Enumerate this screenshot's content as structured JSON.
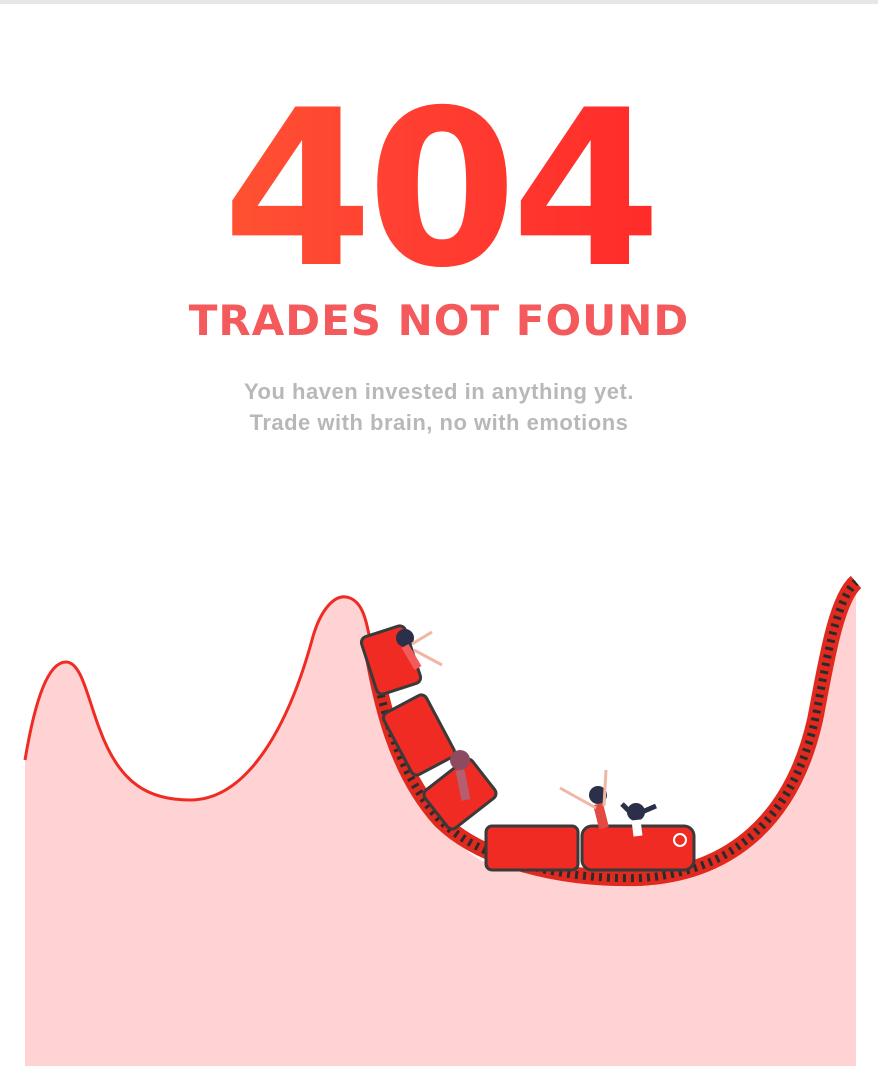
{
  "error": {
    "code": "404",
    "headline": "TRADES NOT FOUND",
    "message_line1": "You haven invested in anything yet.",
    "message_line2": "Trade with brain, no with emotions"
  },
  "colors": {
    "accent_start": "#ff6a33",
    "accent_end": "#ff1a22",
    "headline": "#f4595c",
    "muted_text": "#b8b8b8",
    "area_fill": "#ffd3d3",
    "curve_line": "#ef2b24",
    "track": "#e12a1f"
  },
  "illustration": {
    "subject": "roller-coaster-chart",
    "riders": 4
  }
}
